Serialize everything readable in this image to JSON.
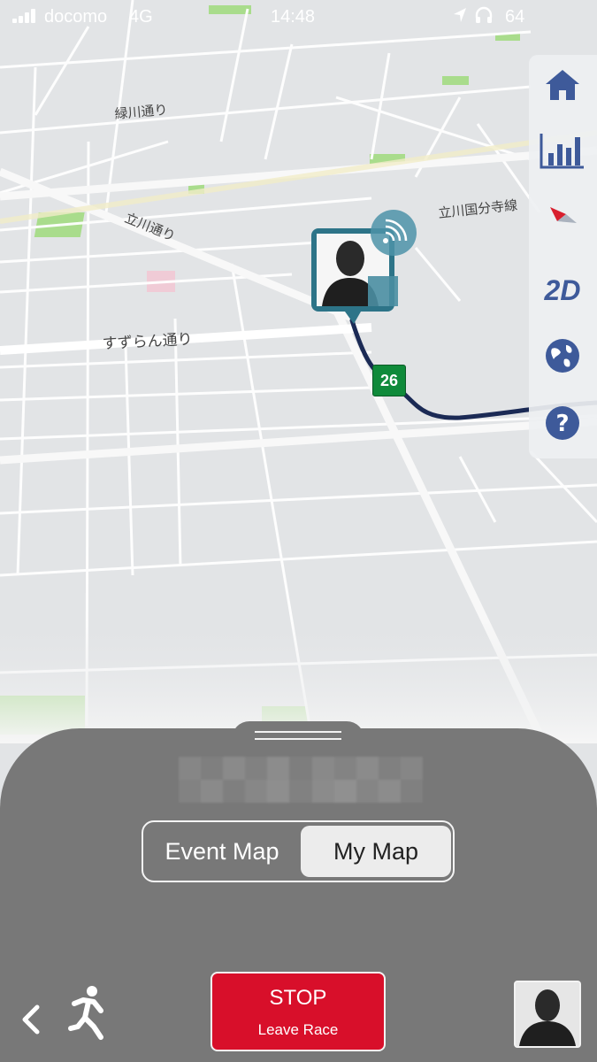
{
  "status_bar": {
    "carrier": "docomo",
    "network": "4G",
    "time": "14:48",
    "battery": "64"
  },
  "map": {
    "street_labels": [
      "緑川通り",
      "立川通り",
      "すずらん通り",
      "立川国分寺線"
    ],
    "distance_marker": "26",
    "route_color": "#1b2a55",
    "park_color": "#a6dc8a"
  },
  "toolbar": {
    "items": [
      {
        "icon": "home-icon"
      },
      {
        "icon": "bar-chart-icon"
      },
      {
        "icon": "compass-icon"
      },
      {
        "icon": "view-mode-icon",
        "label": "2D"
      },
      {
        "icon": "globe-icon"
      },
      {
        "icon": "help-icon"
      }
    ],
    "accent": "#3e5a9a"
  },
  "panel": {
    "segments": {
      "event_map": "Event Map",
      "my_map": "My Map",
      "selected": "My Map"
    },
    "stop_button": {
      "title": "STOP",
      "subtitle": "Leave Race",
      "color": "#d80f2a"
    }
  }
}
